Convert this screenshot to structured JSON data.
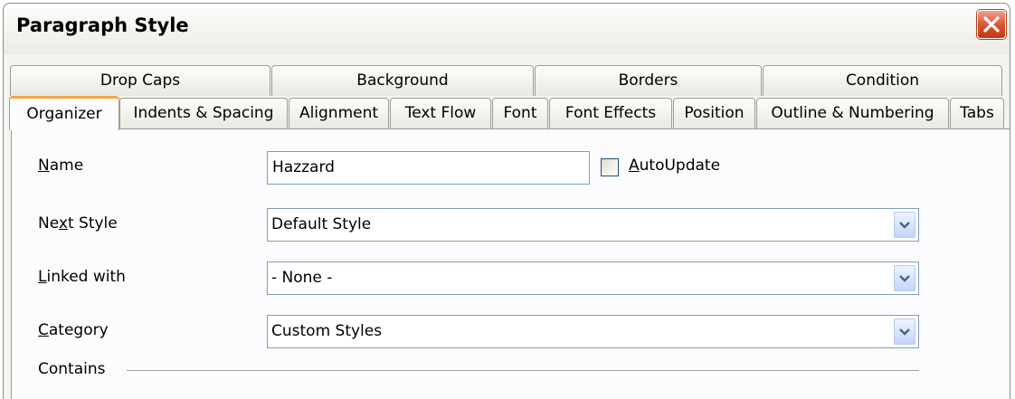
{
  "window": {
    "title": "Paragraph Style"
  },
  "tabs": {
    "back_row": [
      "Drop Caps",
      "Background",
      "Borders",
      "Condition"
    ],
    "front_row": [
      "Organizer",
      "Indents & Spacing",
      "Alignment",
      "Text Flow",
      "Font",
      "Font Effects",
      "Position",
      "Outline & Numbering",
      "Tabs"
    ],
    "active": "Organizer"
  },
  "form": {
    "name": {
      "label_mnemonic": "N",
      "label_rest": "ame",
      "value": "Hazzard"
    },
    "autoupdate": {
      "label_mnemonic": "A",
      "label_rest": "utoUpdate",
      "checked": false
    },
    "next_style": {
      "label_pre": "Ne",
      "label_mnemonic": "x",
      "label_rest": "t Style",
      "value": "Default Style"
    },
    "linked_with": {
      "label_mnemonic": "L",
      "label_rest": "inked with",
      "value": "- None -"
    },
    "category": {
      "label_mnemonic": "C",
      "label_rest": "ategory",
      "value": "Custom Styles"
    },
    "contains": {
      "label": "Contains"
    }
  },
  "icons": {
    "close": "close-icon",
    "dropdown": "chevron-down-icon"
  },
  "colors": {
    "active_tab_accent": "#f2a84a",
    "close_button": "#d85030",
    "field_border": "#7f9db9"
  }
}
